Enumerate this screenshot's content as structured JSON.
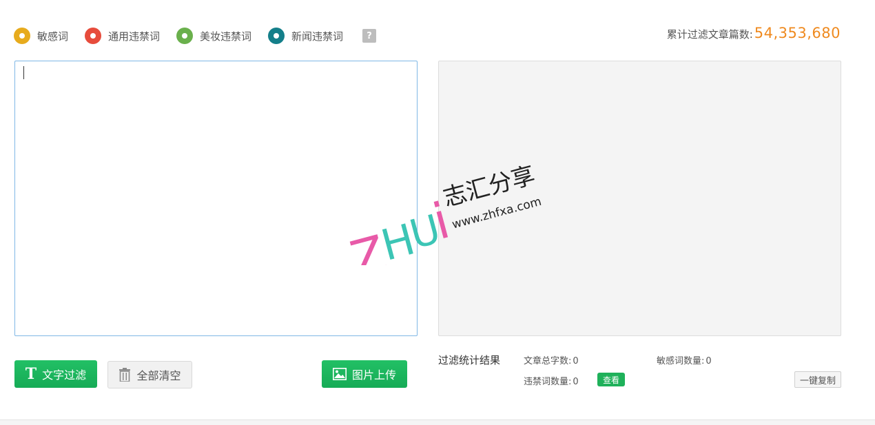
{
  "legend": {
    "items": [
      {
        "label": "敏感词",
        "color": "#e7ab1d"
      },
      {
        "label": "通用违禁词",
        "color": "#e74c3c"
      },
      {
        "label": "美妆违禁词",
        "color": "#6ab04c"
      },
      {
        "label": "新闻违禁词",
        "color": "#147f8a"
      }
    ],
    "help_symbol": "?"
  },
  "counter": {
    "label": "累计过滤文章篇数:",
    "value": "54,353,680"
  },
  "input": {
    "value": "",
    "placeholder": ""
  },
  "buttons": {
    "filter_label": "文字过滤",
    "filter_icon": "T",
    "clear_label": "全部清空",
    "upload_label": "图片上传"
  },
  "stats": {
    "title": "过滤统计结果",
    "total_chars_label": "文章总字数:",
    "total_chars_value": "0",
    "sensitive_count_label": "敏感词数量:",
    "sensitive_count_value": "0",
    "banned_count_label": "违禁词数量:",
    "banned_count_value": "0",
    "view_label": "查看",
    "copy_label": "一键复制"
  },
  "watermark": {
    "brand_letters": "ZHUi",
    "brand_cn": "志汇分享",
    "site": "www.zhfxa.com"
  }
}
